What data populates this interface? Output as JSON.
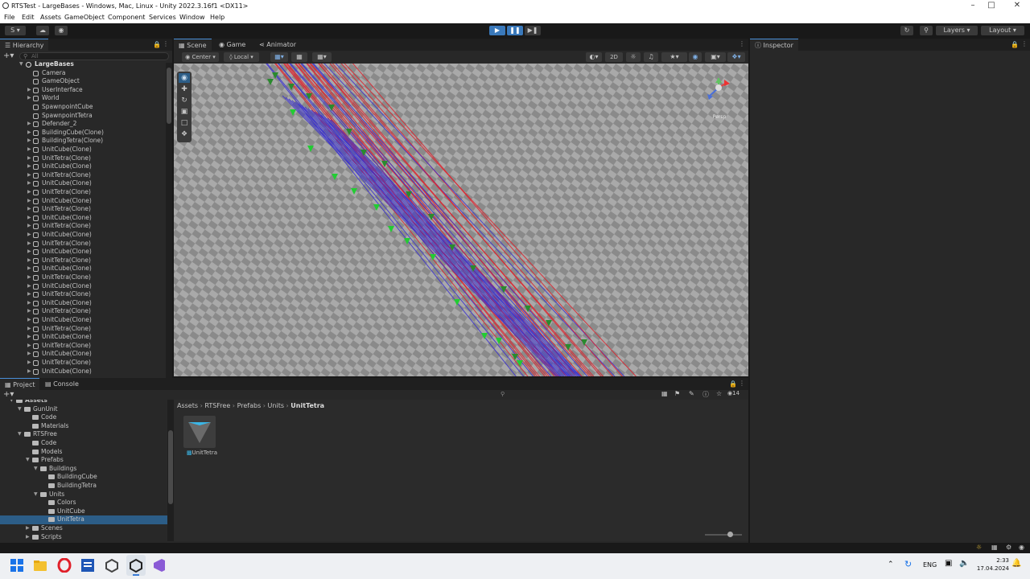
{
  "window": {
    "title": "RTSTest - LargeBases - Windows, Mac, Linux - Unity 2022.3.16f1 <DX11>"
  },
  "menu": [
    "File",
    "Edit",
    "Assets",
    "GameObject",
    "Component",
    "Services",
    "Window",
    "Help"
  ],
  "toolbar": {
    "account": "S",
    "layers": "Layers",
    "layout": "Layout"
  },
  "hierarchy": {
    "tab": "Hierarchy",
    "search_placeholder": "All",
    "scene": "LargeBases",
    "items": [
      "Camera",
      "GameObject",
      "UserInterface",
      "World",
      "SpawnpointCube",
      "SpawnpointTetra",
      "Defender_2",
      "BuildingCube(Clone)",
      "BuildingTetra(Clone)",
      "UnitCube(Clone)",
      "UnitTetra(Clone)",
      "UnitCube(Clone)",
      "UnitTetra(Clone)",
      "UnitCube(Clone)",
      "UnitTetra(Clone)",
      "UnitCube(Clone)",
      "UnitTetra(Clone)",
      "UnitCube(Clone)",
      "UnitTetra(Clone)",
      "UnitCube(Clone)",
      "UnitTetra(Clone)",
      "UnitCube(Clone)",
      "UnitTetra(Clone)",
      "UnitCube(Clone)",
      "UnitTetra(Clone)",
      "UnitCube(Clone)",
      "UnitTetra(Clone)",
      "UnitCube(Clone)",
      "UnitTetra(Clone)",
      "UnitCube(Clone)",
      "UnitTetra(Clone)",
      "UnitCube(Clone)",
      "UnitTetra(Clone)",
      "UnitCube(Clone)",
      "UnitTetra(Clone)",
      "UnitCube(Clone)"
    ]
  },
  "scene_tabs": [
    "Scene",
    "Game",
    "Animator"
  ],
  "scene_toolbar": {
    "pivot": "Center",
    "space": "Local",
    "mode2d": "2D"
  },
  "gizmo": {
    "persp": "Persp"
  },
  "inspector": {
    "tab": "Inspector"
  },
  "project": {
    "tabs": [
      "Project",
      "Console"
    ],
    "tree": [
      {
        "label": "Assets",
        "depth": 0,
        "open": true
      },
      {
        "label": "GunUnit",
        "depth": 1,
        "open": true
      },
      {
        "label": "Code",
        "depth": 2
      },
      {
        "label": "Materials",
        "depth": 2
      },
      {
        "label": "RTSFree",
        "depth": 1,
        "open": true
      },
      {
        "label": "Code",
        "depth": 2
      },
      {
        "label": "Models",
        "depth": 2
      },
      {
        "label": "Prefabs",
        "depth": 2,
        "open": true
      },
      {
        "label": "Buildings",
        "depth": 3,
        "open": true
      },
      {
        "label": "BuildingCube",
        "depth": 4
      },
      {
        "label": "BuildingTetra",
        "depth": 4
      },
      {
        "label": "Units",
        "depth": 3,
        "open": true
      },
      {
        "label": "Colors",
        "depth": 4
      },
      {
        "label": "UnitCube",
        "depth": 4
      },
      {
        "label": "UnitTetra",
        "depth": 4,
        "selected": true
      },
      {
        "label": "Scenes",
        "depth": 2
      },
      {
        "label": "Scripts",
        "depth": 2
      }
    ],
    "breadcrumb": [
      "Assets",
      "RTSFree",
      "Prefabs",
      "Units",
      "UnitTetra"
    ],
    "asset_label": "UnitTetra",
    "count": "14"
  },
  "taskbar": {
    "lang": "ENG",
    "time": "2:33",
    "date": "17.04.2024"
  },
  "colors": {
    "accent": "#4a90d9",
    "selection": "#2c5d87",
    "red_lines": "#e0202a",
    "blue_lines": "#3a30d0",
    "green_units": "#22cc33"
  }
}
